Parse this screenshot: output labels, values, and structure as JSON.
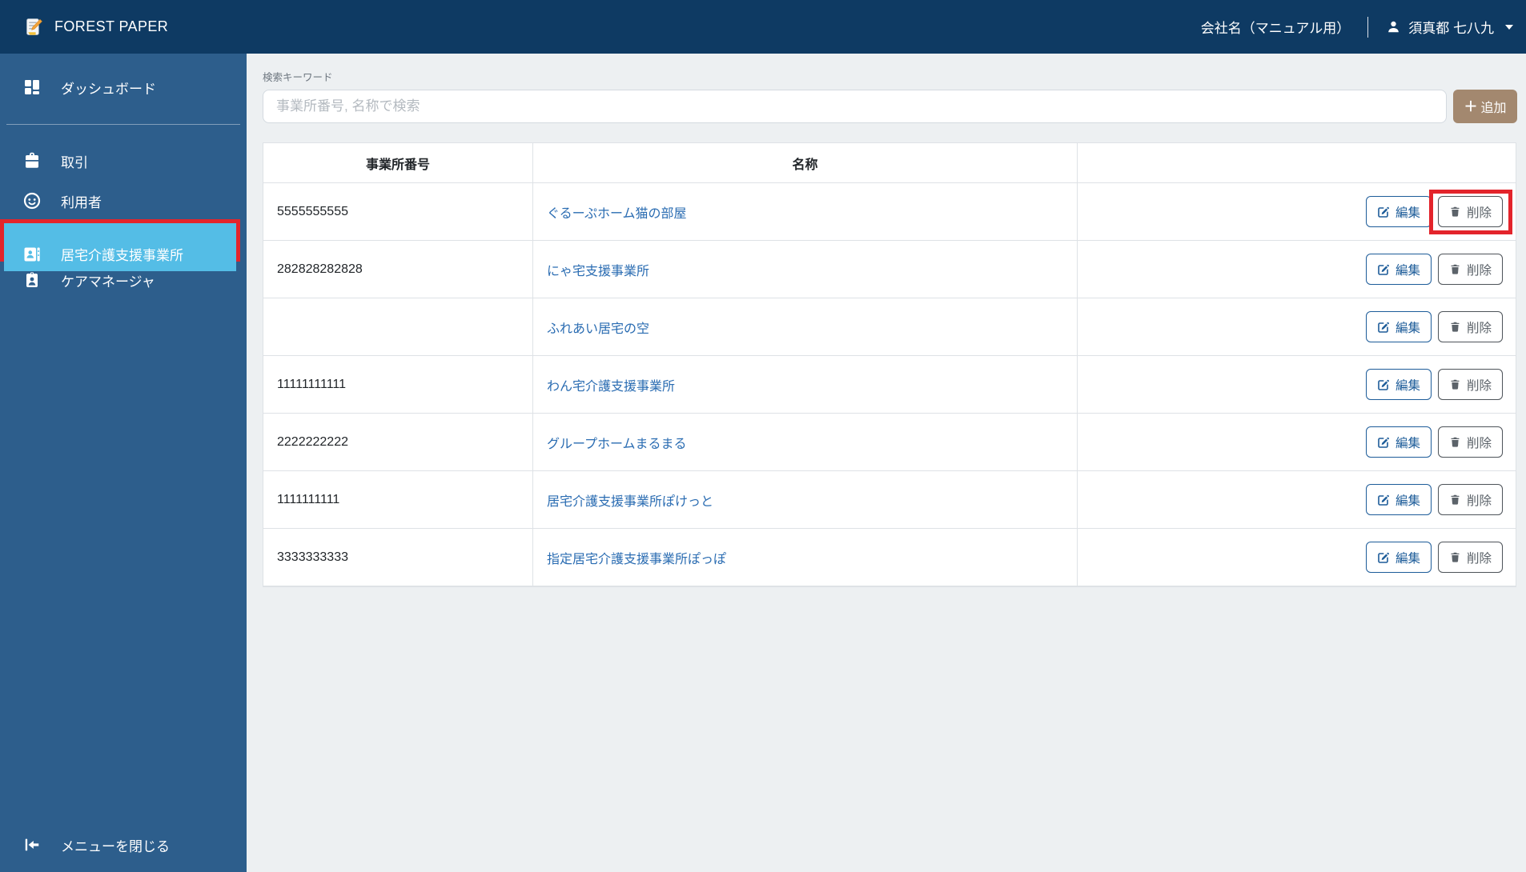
{
  "topbar": {
    "brand": "FOREST PAPER",
    "company": "会社名（マニュアル用）",
    "user": "須真都 七八九"
  },
  "sidebar": {
    "items": [
      {
        "label": "ダッシュボード",
        "icon": "dashboard-icon",
        "selected": false
      },
      {
        "label": "取引",
        "icon": "briefcase-icon",
        "selected": false
      },
      {
        "label": "利用者",
        "icon": "face-icon",
        "selected": false
      },
      {
        "label": "居宅介護支援事業所",
        "icon": "address-card-icon",
        "selected": true,
        "annotated": true
      },
      {
        "label": "ケアマネージャ",
        "icon": "id-badge-icon",
        "selected": false
      }
    ],
    "close_menu": "メニューを閉じる"
  },
  "search": {
    "label": "検索キーワード",
    "placeholder": "事業所番号, 名称で検索",
    "add_button": "追加"
  },
  "table": {
    "columns": [
      "事業所番号",
      "名称",
      ""
    ],
    "actions": {
      "edit": "編集",
      "delete": "削除"
    },
    "rows": [
      {
        "number": "5555555555",
        "name": "ぐるーぷホーム猫の部屋",
        "delete_annotated": true
      },
      {
        "number": "282828282828",
        "name": "にゃ宅支援事業所",
        "delete_annotated": false
      },
      {
        "number": "",
        "name": "ふれあい居宅の空",
        "delete_annotated": false
      },
      {
        "number": "11111111111",
        "name": "わん宅介護支援事業所",
        "delete_annotated": false
      },
      {
        "number": "2222222222",
        "name": "グループホームまるまる",
        "delete_annotated": false
      },
      {
        "number": "1111111111",
        "name": "居宅介護支援事業所ぽけっと",
        "delete_annotated": false
      },
      {
        "number": "3333333333",
        "name": "指定居宅介護支援事業所ぽっぽ",
        "delete_annotated": false
      }
    ]
  },
  "annotations": {
    "color": "#e3242b",
    "sidebar_highlight_target": "居宅介護支援事業所",
    "delete_highlight_target_row": "5555555555"
  },
  "colors": {
    "topbar_bg": "#0e3a63",
    "sidebar_bg": "#2d5e8c",
    "sidebar_selected_bg": "#54bde6",
    "page_bg": "#edf0f2",
    "add_button_bg": "#a3886f",
    "link_blue": "#2a6cb2",
    "edit_button_blue": "#1d5c99",
    "delete_button_gray": "#4d5359",
    "annotation_red": "#e3242b"
  }
}
